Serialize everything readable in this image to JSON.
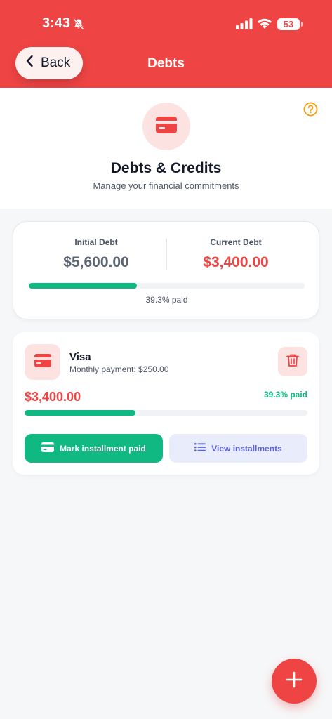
{
  "status_bar": {
    "time": "3:43",
    "battery": "53"
  },
  "header": {
    "back_label": "Back",
    "title": "Debts"
  },
  "intro": {
    "title": "Debts & Credits",
    "subtitle": "Manage your financial commitments"
  },
  "summary": {
    "initial_label": "Initial Debt",
    "initial_value": "$5,600.00",
    "current_label": "Current Debt",
    "current_value": "$3,400.00",
    "progress_fraction": 0.393,
    "paid_text": "39.3% paid"
  },
  "debts": [
    {
      "name": "Visa",
      "monthly_payment": "Monthly payment: $250.00",
      "amount": "$3,400.00",
      "paid_text": "39.3% paid",
      "progress_fraction": 0.393,
      "mark_label": "Mark installment paid",
      "view_label": "View installments"
    }
  ],
  "colors": {
    "primary": "#ef4444",
    "success": "#10b981",
    "accent_indigo": "#5b62d6",
    "help": "#f59e0b"
  },
  "icons": {
    "back": "chevron-left-icon",
    "help": "question-circle-icon",
    "card": "credit-card-icon",
    "delete": "trash-icon",
    "list": "list-icon",
    "add": "plus-icon"
  }
}
